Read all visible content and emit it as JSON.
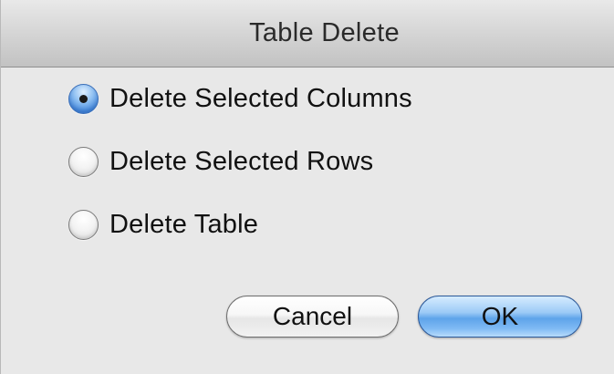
{
  "window": {
    "title": "Table Delete"
  },
  "options": [
    {
      "label": "Delete Selected Columns",
      "selected": true
    },
    {
      "label": "Delete Selected Rows",
      "selected": false
    },
    {
      "label": "Delete Table",
      "selected": false
    }
  ],
  "buttons": {
    "cancel_label": "Cancel",
    "ok_label": "OK"
  },
  "colors": {
    "accent": "#5ea4ea",
    "window_background": "#e8e8e8"
  }
}
